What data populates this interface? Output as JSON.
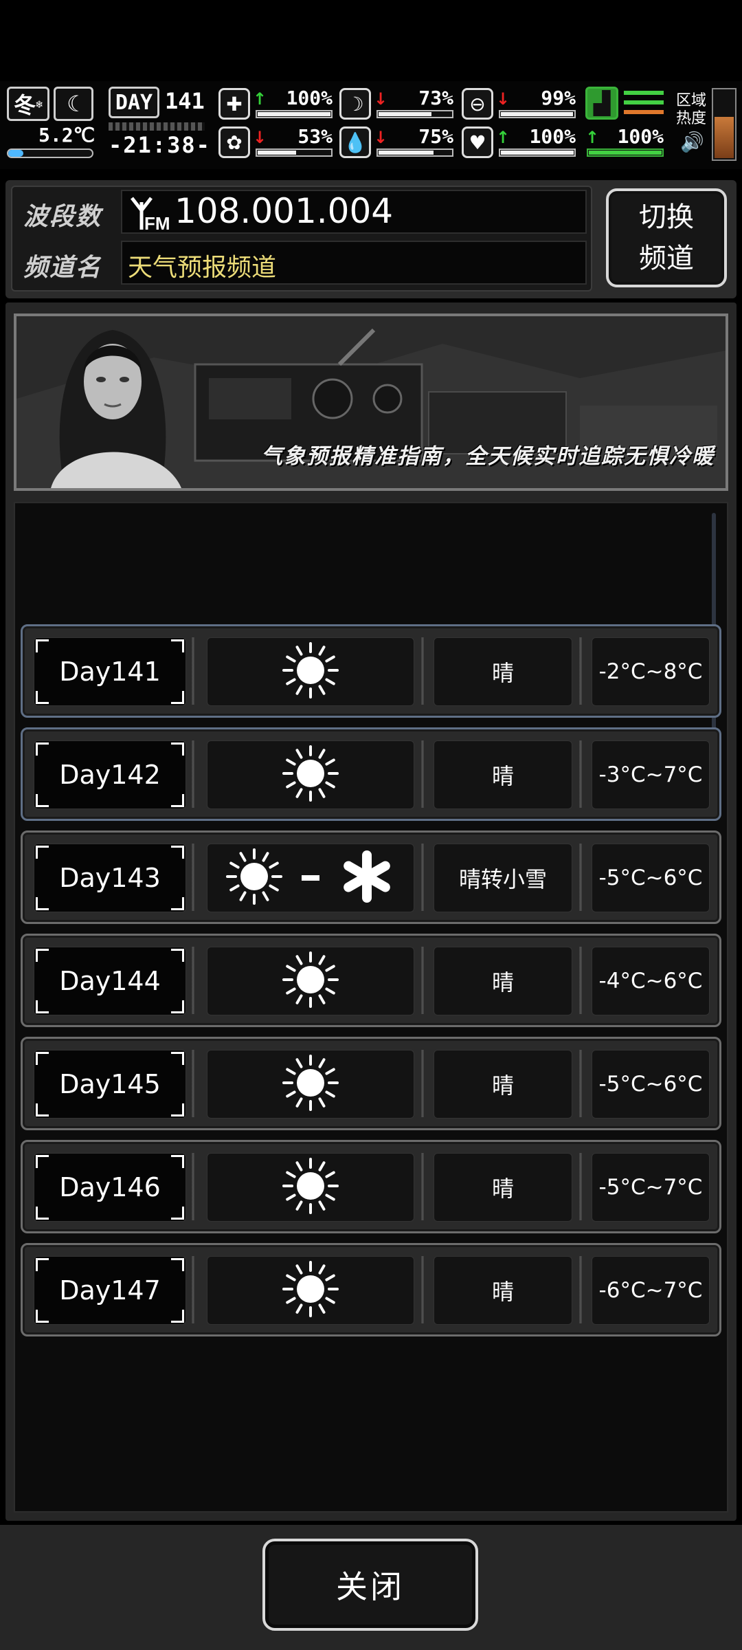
{
  "hud": {
    "season": "冬",
    "temperature": "5.2℃",
    "day_label": "DAY",
    "day_number": "141",
    "time": "-21:38-",
    "stats": [
      {
        "id": "health",
        "value": "100%",
        "trend": "up",
        "fill": 1.0
      },
      {
        "id": "hunger",
        "value": "73%",
        "trend": "down",
        "fill": 0.73
      },
      {
        "id": "fatigue",
        "value": "99%",
        "trend": "down",
        "fill": 0.99
      },
      {
        "id": "mood",
        "value": "53%",
        "trend": "down",
        "fill": 0.53
      },
      {
        "id": "thirst",
        "value": "75%",
        "trend": "down",
        "fill": 0.75
      },
      {
        "id": "heart",
        "value": "100%",
        "trend": "up",
        "fill": 1.0
      }
    ],
    "stamina": {
      "value": "100%",
      "trend": "up",
      "fill": 1.0
    },
    "region_heat_label_1": "区域",
    "region_heat_label_2": "热度"
  },
  "radio": {
    "band_label": "波段数",
    "band_value": "108.001.004",
    "channel_label": "频道名",
    "channel_value": "天气预报频道",
    "switch_line1": "切换",
    "switch_line2": "频道"
  },
  "banner": {
    "caption": "气象预报精准指南，全天候实时追踪无惧冷暖"
  },
  "forecast": [
    {
      "day": "Day141",
      "weather": "晴",
      "temp": "-2°C~8°C",
      "icons": [
        "sun"
      ],
      "selected": true
    },
    {
      "day": "Day142",
      "weather": "晴",
      "temp": "-3°C~7°C",
      "icons": [
        "sun"
      ],
      "selected": true
    },
    {
      "day": "Day143",
      "weather": "晴转小雪",
      "temp": "-5°C~6°C",
      "icons": [
        "sun",
        "snow"
      ],
      "selected": false
    },
    {
      "day": "Day144",
      "weather": "晴",
      "temp": "-4°C~6°C",
      "icons": [
        "sun"
      ],
      "selected": false
    },
    {
      "day": "Day145",
      "weather": "晴",
      "temp": "-5°C~6°C",
      "icons": [
        "sun"
      ],
      "selected": false
    },
    {
      "day": "Day146",
      "weather": "晴",
      "temp": "-5°C~7°C",
      "icons": [
        "sun"
      ],
      "selected": false
    },
    {
      "day": "Day147",
      "weather": "晴",
      "temp": "-6°C~7°C",
      "icons": [
        "sun"
      ],
      "selected": false
    }
  ],
  "close_label": "关闭"
}
